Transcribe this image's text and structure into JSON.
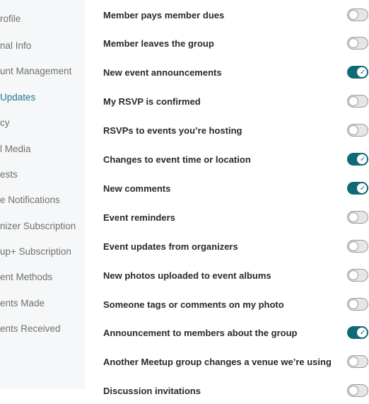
{
  "sidebar": {
    "items": [
      {
        "label": "rofile",
        "active": false
      },
      {
        "label": "nal Info",
        "active": false
      },
      {
        "label": "unt Management",
        "active": false
      },
      {
        "label": "Updates",
        "active": true
      },
      {
        "label": "cy",
        "active": false
      },
      {
        "label": "l Media",
        "active": false
      },
      {
        "label": "ests",
        "active": false
      },
      {
        "label": "e Notifications",
        "active": false
      },
      {
        "label": "nizer Subscription",
        "active": false
      },
      {
        "label": "up+ Subscription",
        "active": false
      },
      {
        "label": "ent Methods",
        "active": false
      },
      {
        "label": "ents Made",
        "active": false
      },
      {
        "label": "ents Received",
        "active": false
      }
    ]
  },
  "settings": [
    {
      "label": "Member pays member dues",
      "enabled": false
    },
    {
      "label": "Member leaves the group",
      "enabled": false
    },
    {
      "label": "New event announcements",
      "enabled": true
    },
    {
      "label": "My RSVP is confirmed",
      "enabled": false
    },
    {
      "label": "RSVPs to events you’re hosting",
      "enabled": false
    },
    {
      "label": "Changes to event time or location",
      "enabled": true
    },
    {
      "label": "New comments",
      "enabled": true
    },
    {
      "label": "Event reminders",
      "enabled": false
    },
    {
      "label": "Event updates from organizers",
      "enabled": false
    },
    {
      "label": "New photos uploaded to event albums",
      "enabled": false
    },
    {
      "label": "Someone tags or comments on my photo",
      "enabled": false
    },
    {
      "label": "Announcement to members about the group",
      "enabled": true
    },
    {
      "label": "Another Meetup group changes a venue we’re using",
      "enabled": false
    },
    {
      "label": "Discussion invitations",
      "enabled": false
    }
  ],
  "colors": {
    "accent": "#0f6a78",
    "active_nav": "#1c7a8a",
    "sidebar_bg": "#f6f7f8"
  },
  "icons": {
    "toggle_on": "check-icon"
  }
}
